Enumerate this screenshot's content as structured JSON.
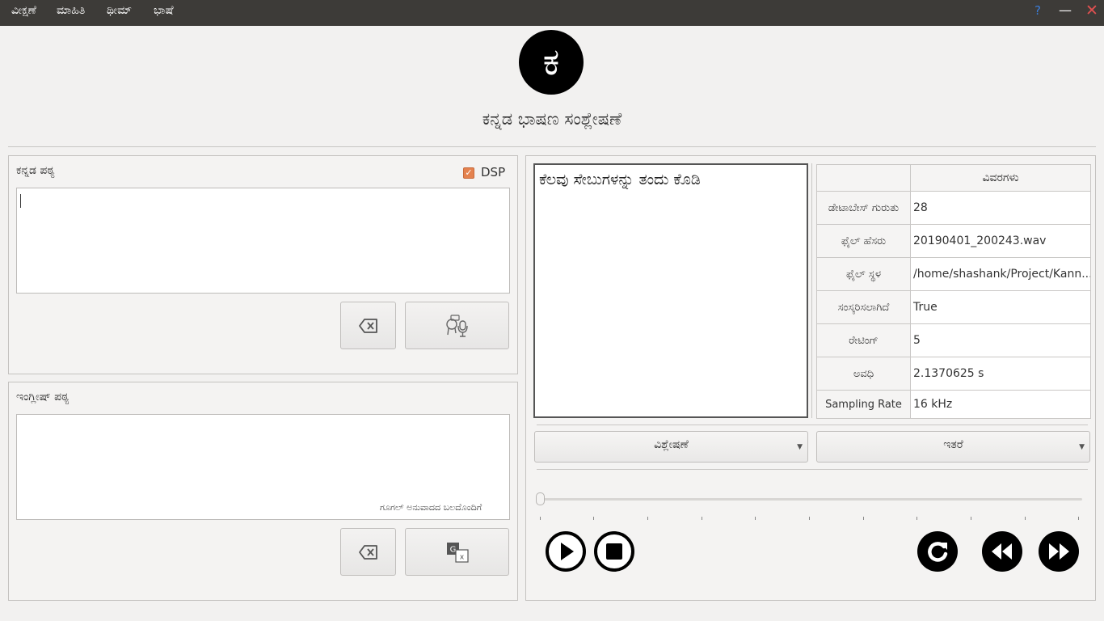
{
  "menu": [
    "ವೀಕ್ಷಣೆ",
    "ಮಾಹಿತಿ",
    "ಥೀಮ್",
    "ಭಾಷೆ"
  ],
  "window": {
    "help": "?",
    "minimize": "—",
    "close": "✕"
  },
  "logo_letter": "ಕ",
  "app_title": "ಕನ್ನಡ ಭಾಷಣ ಸಂಶ್ಲೇಷಣೆ",
  "kannada_panel": {
    "label": "ಕನ್ನಡ ಪಠ್ಯ",
    "dsp_label": "DSP",
    "dsp_checked": true,
    "text": ""
  },
  "english_panel": {
    "label": "ಇಂಗ್ಲೀಷ್ ಪಠ್ಯ",
    "text": "",
    "powered_by": "ಗೂಗಲ್ ಅನುವಾದದ ಬಲದೊಂದಿಗೆ"
  },
  "sentence_text": "ಕೆಲವು ಸೇಬುಗಳನ್ನು ತಂದು ಕೊಡಿ",
  "details": {
    "header": "ವಿವರಗಳು",
    "rows": [
      {
        "key": "ಡೇಟಾಬೇಸ್ ಗುರುತು",
        "value": "28"
      },
      {
        "key": "ಫೈಲ್ ಹೆಸರು",
        "value": "20190401_200243.wav"
      },
      {
        "key": "ಫೈಲ್ ಸ್ಥಳ",
        "value": "/home/shashank/Project/Kann..."
      },
      {
        "key": "ಸಂಸ್ಕರಿಸಲಾಗಿದೆ",
        "value": "True"
      },
      {
        "key": "ರೇಟಿಂಗ್",
        "value": "5"
      },
      {
        "key": "ಅವಧಿ",
        "value": "2.1370625 s"
      },
      {
        "key": "Sampling Rate",
        "value": "16 kHz"
      }
    ]
  },
  "dropdowns": {
    "analysis": "ವಿಶ್ಲೇಷಣೆ",
    "other": "ಇತರೆ"
  },
  "playback": {
    "position_fraction": 0
  },
  "colors": {
    "topbar": "#3d3b38",
    "accent": "#e4824f",
    "close": "#e05050",
    "help": "#3b7dd8"
  }
}
